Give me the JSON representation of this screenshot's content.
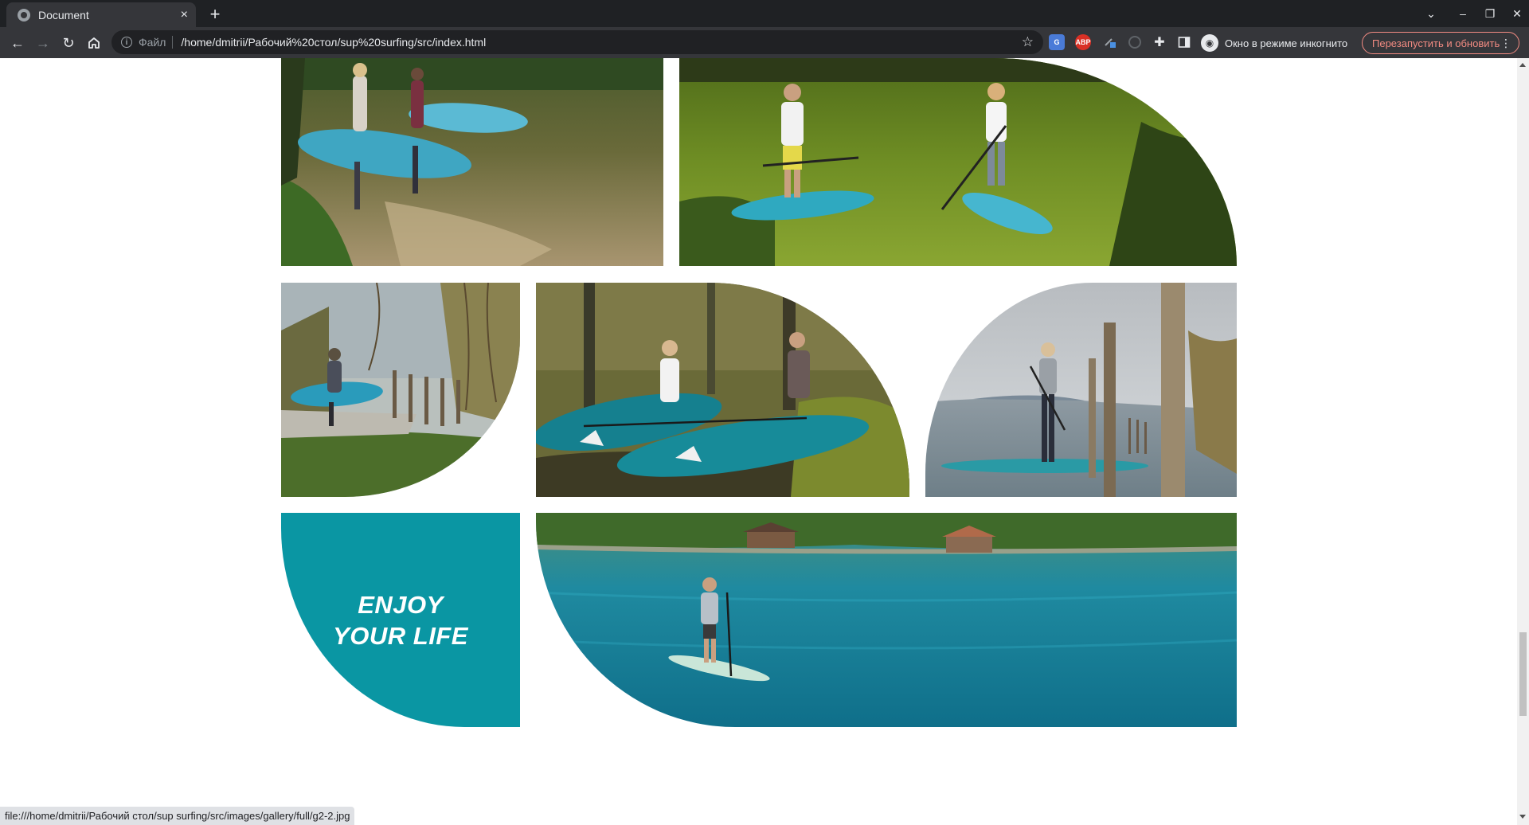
{
  "browser": {
    "tab_title": "Document",
    "tab_close": "×",
    "new_tab": "+",
    "address": {
      "scheme_label": "Файл",
      "url": "/home/dmitrii/Рабочий%20стол/sup%20surfing/src/index.html"
    },
    "extensions": [
      "translate-extension-icon",
      "adblock-plus-icon",
      "pen-extension-icon",
      "globe-extension-icon",
      "puzzle-extensions-icon",
      "side-panel-icon"
    ],
    "adblock_label": "ABP",
    "incognito_label": "Окно в режиме инкогнито",
    "relaunch_label": "Перезапустить и обновить",
    "status_url": "file:///home/dmitrii/Рабочий стол/sup surfing/src/images/gallery/full/g2-2.jpg",
    "colors": {
      "tab_bar": "#1f2124",
      "toolbar": "#35363a",
      "omnibox": "#202124",
      "relaunch": "#f28b82"
    }
  },
  "gallery": {
    "tagline_line1": "ENJOY",
    "tagline_line2": "YOUR LIFE",
    "accent_color": "#0a96a3",
    "photos": [
      "Two people carrying blue paddle boards along a lake shore",
      "Two people with paddle boards standing in green shallow water",
      "Person carrying a board past a wooden fence through trees",
      "Two people carrying teal boards through a forest",
      "Woman standing on a paddle board next to wooden posts in a lake",
      "Man paddle boarding on a turquoise lake with boathouses"
    ]
  }
}
